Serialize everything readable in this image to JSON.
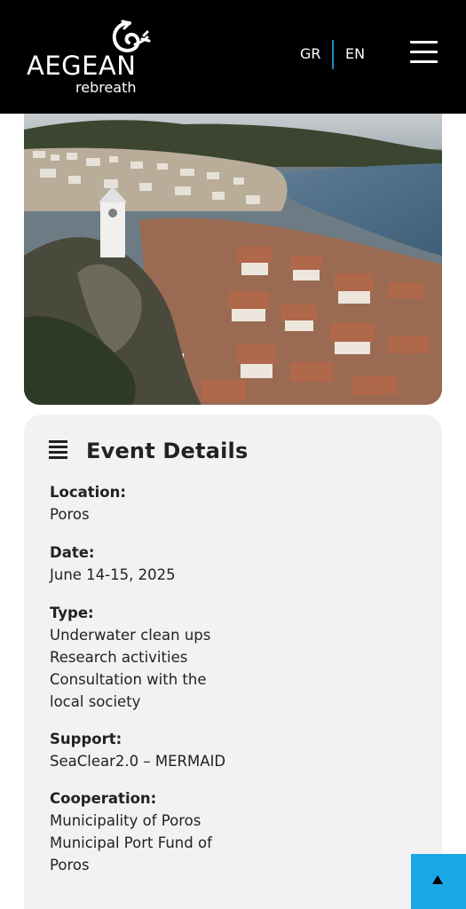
{
  "header": {
    "logo": {
      "word": "AEGEAN",
      "sub": "rebreath"
    },
    "languages": [
      "GR",
      "EN"
    ],
    "menu_icon": "hamburger-menu-icon"
  },
  "hero_image": {
    "subject": "aerial-town-bay-photo"
  },
  "event_details": {
    "title": "Event Details",
    "icon": "list-icon",
    "fields": [
      {
        "label": "Location:",
        "values": [
          "Poros"
        ]
      },
      {
        "label": "Date:",
        "values": [
          "June 14-15, 2025"
        ]
      },
      {
        "label": "Type:",
        "values": [
          "Underwater clean ups",
          "Research activities",
          "Consultation with the",
          "local society"
        ]
      },
      {
        "label": "Support:",
        "values": [
          "SeaClear2.0 – MERMAID"
        ]
      },
      {
        "label": "Cooperation:",
        "values": [
          "Municipality of Poros",
          "Municipal Port Fund of",
          "Poros"
        ]
      }
    ]
  },
  "scroll_top": {
    "icon": "arrow-up-icon",
    "color": "#1aa7e6"
  },
  "colors": {
    "header_bg": "#000000",
    "accent": "#1aa7e6",
    "card_bg": "#f2f2f2",
    "separator": "#1f88c9"
  }
}
